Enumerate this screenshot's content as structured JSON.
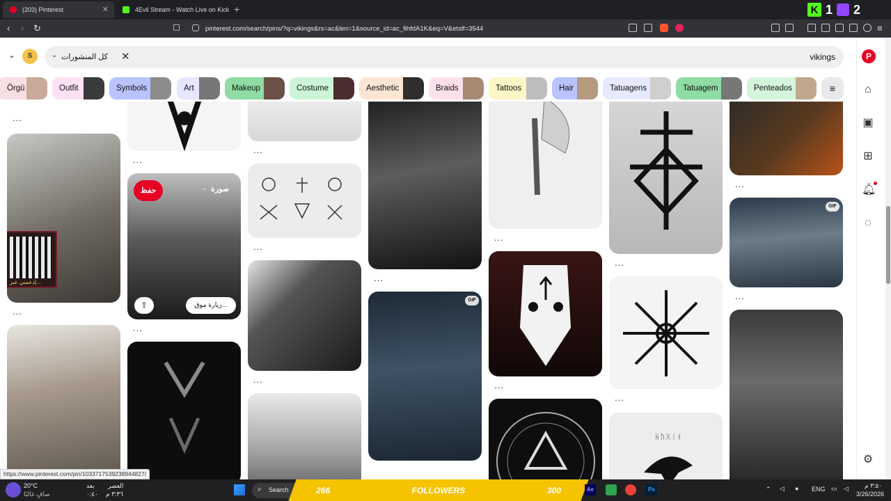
{
  "browser": {
    "tabs": [
      {
        "title": "(203) Pinterest",
        "active": true,
        "favicon_color": "#e60023"
      },
      {
        "title": "4Evil Stream - Watch Live on Kick",
        "active": false,
        "favicon_color": "#53fc18"
      }
    ],
    "new_tab": "+",
    "url": "pinterest.com/search/pins/?q=vikings&rs=ac&len=1&source_id=ac_fihfdA1K&eq=V&etslf=3544",
    "status_url": "https://www.pinterest.com/pin/1033717539238944827/",
    "ext_badges": [
      "1",
      "2"
    ]
  },
  "search": {
    "query": "vikings",
    "scope": "كل المنشورات",
    "avatar_letter": "S",
    "brand_color": "#e60023"
  },
  "filters": [
    {
      "label": "Örgü",
      "color": "#f6e0e3"
    },
    {
      "label": "Outfit",
      "color": "#fde2f5"
    },
    {
      "label": "Symbols",
      "color": "#b9c3ff"
    },
    {
      "label": "Art",
      "color": "#e6e6ff"
    },
    {
      "label": "Makeup",
      "color": "#8fdca4"
    },
    {
      "label": "Costume",
      "color": "#cbf5d6"
    },
    {
      "label": "Aesthetic",
      "color": "#fde5d3"
    },
    {
      "label": "Braids",
      "color": "#fde1ea"
    },
    {
      "label": "Tattoos",
      "color": "#fff6c7"
    },
    {
      "label": "Hair",
      "color": "#b9c3ff"
    },
    {
      "label": "Tatuagens",
      "color": "#e6e9ff"
    },
    {
      "label": "Tatuagem",
      "color": "#8fdca4"
    },
    {
      "label": "Penteados",
      "color": "#d3f5dc"
    }
  ],
  "pin_overlay": {
    "save": "حفظ",
    "board": "صورة",
    "visit": "زيارة موق...",
    "qr_caption": "إدعمني عبر..."
  },
  "badges": {
    "gif": "GIF"
  },
  "overlay_text": {
    "rune_word": "ᚺᚢᚷᛁᚾ",
    "dots": "..."
  },
  "taskbar": {
    "weather_temp": "20°C",
    "weather_desc": "صافٍ غالبًا",
    "prayer_label": "العصر",
    "prayer_time": "٣:٣٦ م",
    "after_label": "بعد",
    "after_value": "٠:٤٠",
    "search": "Search",
    "banner_left": "266",
    "banner_center": "FOLLOWERS",
    "banner_right": "300",
    "lang": "ENG",
    "time": "٣:٥٠ م",
    "date": "3/26/2026"
  }
}
